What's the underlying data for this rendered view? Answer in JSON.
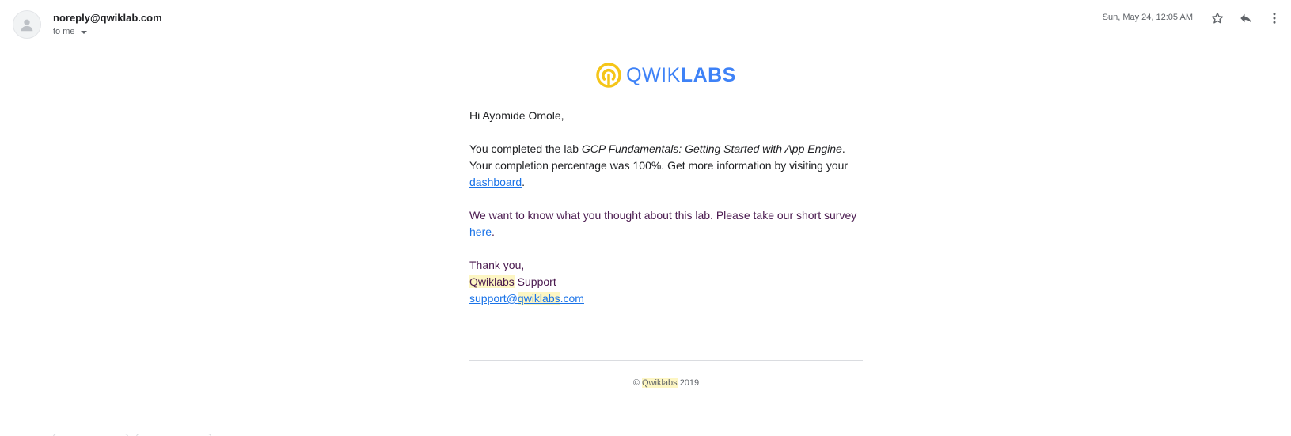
{
  "header": {
    "sender": "noreply@qwiklab.com",
    "recipients": "to me",
    "date": "Sun, May 24, 12:05 AM"
  },
  "icons": {
    "avatar": "person-icon",
    "star": "star-icon",
    "reply": "reply-icon",
    "more": "more-vert-icon",
    "logo": "qwiklabs-logo-icon"
  },
  "colors": {
    "link": "#1a73e8",
    "logo_blue": "#3e82f7",
    "logo_yellow": "#f5c518",
    "highlight": "#fdf6c3",
    "purple_text": "#4a1a4f"
  },
  "logo": {
    "thin": "QWIK",
    "bold": "LABS"
  },
  "body": {
    "greeting": "Hi Ayomide Omole,",
    "completed_prefix": "You completed the lab ",
    "lab_name": "GCP Fundamentals: Getting Started with App Engine",
    "completed_suffix": ". Your completion percentage was 100%. Get more information by visiting your ",
    "dashboard_link": "dashboard",
    "period1": ".",
    "survey_prefix": "We want to know what you thought about this lab. Please take our short survey ",
    "survey_link": "here",
    "period2": ".",
    "thanks": "Thank you,",
    "sig_brand": "Qwiklabs",
    "sig_rest": " Support",
    "email_pre": "support@",
    "email_brand": "qwiklabs",
    "email_post": ".com"
  },
  "footer": {
    "copyright_symbol": "©",
    "brand": "Qwiklabs",
    "year": "2019"
  }
}
